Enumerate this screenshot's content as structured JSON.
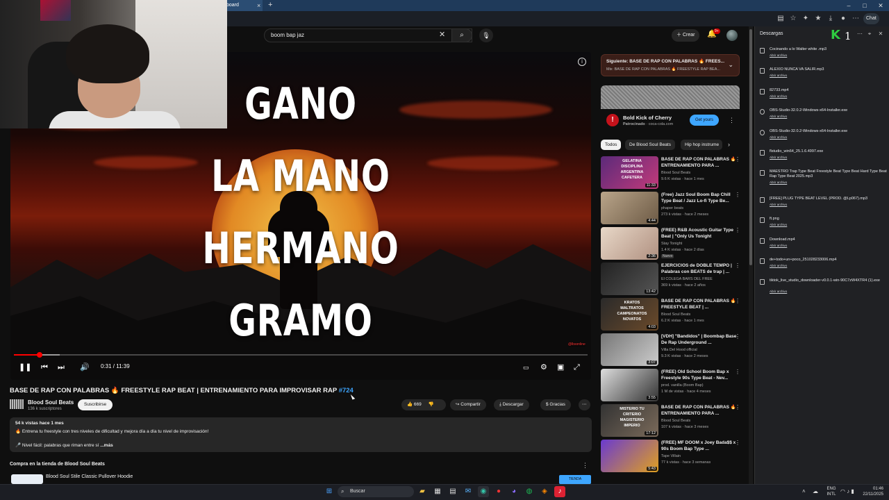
{
  "browser": {
    "tab_title": "board",
    "tab_close": "×",
    "new_tab": "+",
    "window_buttons": [
      "–",
      "□",
      "✕"
    ],
    "chat_label": "Chat"
  },
  "youtube": {
    "search": {
      "value": "boom bap jaz",
      "clear": "✕",
      "search_icon": "⌕",
      "mic_icon": "🎙"
    },
    "header": {
      "create_label": "Crear",
      "notifications_badge": "9+"
    },
    "player": {
      "overlay_lines": [
        "GANO",
        "LA MANO",
        "HERMANO",
        "GRAMO"
      ],
      "watermark": "@lbsonline",
      "time": "0:31 / 11:39",
      "progress_fraction": 0.045,
      "buffered_fraction": 0.08
    },
    "video": {
      "title": "BASE DE RAP CON PALABRAS 🔥 FREESTYLE RAP BEAT | ENTRENAMIENTO PARA IMPROVISAR RAP ",
      "hashtag": "#724",
      "channel": "Blood Soul Beats",
      "subscribers": "136 k suscriptores",
      "subscribe_label": "Suscribirse",
      "likes": "669",
      "share_label": "Compartir",
      "download_label": "Descargar",
      "thanks_label": "Gracias",
      "description": {
        "stats": "54 k vistas  hace 1 mes",
        "line1": "🔥 Entrena tu freestyle con tres niveles de dificultad y mejora día a día tu nivel de improvisación!",
        "line2": "🎤 Nivel fácil: palabras que riman entre sí",
        "more": "...más"
      },
      "shop_title": "Compra en la tienda de Blood Soul Beats",
      "shop_item": "Blood Soul Stile Classic Pullover Hoodie",
      "shop_button": "TIENDA"
    },
    "next_up": {
      "label": "Siguiente: BASE DE RAP CON PALABRAS 🔥 FREES...",
      "sub": "Mix: BASE DE RAP CON PALABRAS 🔥 FREESTYLE RAP BEA..."
    },
    "ad": {
      "title": "Bold Kick of Cherry",
      "sponsor": "Patrocinado",
      "domain": "coca-cola.com",
      "button": "Get yours"
    },
    "chips": [
      "Todos",
      "De Blood Soul Beats",
      "Hip hop instrume"
    ],
    "recommendations": [
      {
        "title": "BASE DE RAP CON PALABRAS 🔥 ENTRENAMIENTO PARA ...",
        "channel": "Blood Soul Beats",
        "meta": "9.6 K vistas · hace 1 mes",
        "duration": "11:33",
        "thumb_text": "GELATINA DISCIPLINA ARGENTINA CAFETERA",
        "badge": ""
      },
      {
        "title": "(Free) Jazz Soul Boom Bap Chill Type Beat / Jazz Lo-fi Type Be...",
        "channel": "phaper beats",
        "meta": "273 k vistas · hace 2 meses",
        "duration": "4:44",
        "thumb_text": "",
        "badge": ""
      },
      {
        "title": "(FREE) R&B Acoustic Guitar Type Beat | \"Only Us Tonight",
        "channel": "Stay Tonight",
        "meta": "1.4 K vistas · hace 2 días",
        "duration": "2:36",
        "thumb_text": "",
        "badge": "Nuevo"
      },
      {
        "title": "EJERCICIOS de DOBLE TEMPO | Palabras con BEATS de trap | ...",
        "channel": "El COLEGA BARS DEL FREE",
        "meta": "369 k vistas · hace 2 años",
        "duration": "13:42",
        "thumb_text": "",
        "badge": ""
      },
      {
        "title": "BASE DE RAP CON PALABRAS 🔥 FREESTYLE BEAT | ...",
        "channel": "Blood Soul Beats",
        "meta": "6.2 K vistas · hace 1 mes",
        "duration": "4:03",
        "thumb_text": "KRATOS MALTRATOS CAMPEONATOS NOVATOS",
        "badge": ""
      },
      {
        "title": "[VDH] \"Bandidos\" | Boombap Base De Rap Underground ...",
        "channel": "Villa Del Hood official",
        "meta": "9.3 K vistas · hace 2 meses",
        "duration": "3:07",
        "thumb_text": "",
        "badge": ""
      },
      {
        "title": "(FREE) Old School Boom Bap x Freestyle 90s Type Beat - Nev...",
        "channel": "prod. vanilla (Boom Bap)",
        "meta": "1 M de vistas · hace 4 meses",
        "duration": "3:55",
        "thumb_text": "",
        "badge": ""
      },
      {
        "title": "BASE DE RAP CON PALABRAS 🔥 ENTRENAMIENTO PARA ...",
        "channel": "Blood Soul Beats",
        "meta": "107 k vistas · hace 3 meses",
        "duration": "17:12",
        "thumb_text": "MISTERIO TU CRITERIO MAGISTERIO IMPERIO",
        "badge": ""
      },
      {
        "title": "(FREE) MF DOOM x Joey Bada$$ x 90s Boom Bap Type ...",
        "channel": "Tape Villain",
        "meta": "77 k vistas · hace 3 semanas",
        "duration": "5:43",
        "thumb_text": "",
        "badge": ""
      }
    ]
  },
  "downloads": {
    "title": "Descargas",
    "open_label": "Abrir archivo",
    "items": [
      {
        "name": "Cocinando a lo Walter white .mp3",
        "link": "Abrir archivo",
        "icon": "file"
      },
      {
        "name": "ALEXIO NUNCA VA SALIR.mp3",
        "link": "Abrir archivo",
        "icon": "file"
      },
      {
        "name": "82733.mp4",
        "link": "Abrir archivo",
        "icon": "file"
      },
      {
        "name": "OBS-Studio-32.0.2-Windows-x64-Installer.exe",
        "link": "Abrir archivo",
        "icon": "round"
      },
      {
        "name": "OBS-Studio-32.0.2-Windows-x64-Installer.exe",
        "link": "Abrir archivo",
        "icon": "round"
      },
      {
        "name": "flstudio_win64_25.1.6.4997.exe",
        "link": "Abrir archivo",
        "icon": "file"
      },
      {
        "name": "MAESTRO Trap Type Beat Freestyle Beat Type Beat Hard Type Beat Rap Type Beat 2025.mp3",
        "link": "Abrir archivo",
        "icon": "file"
      },
      {
        "name": "[FREE] PLUG TYPE BEAT LEVEL (PROD. @Lp067).mp3",
        "link": "Abrir archivo",
        "icon": "file"
      },
      {
        "name": "ft.png",
        "link": "Abrir archivo",
        "icon": "file"
      },
      {
        "name": "Download.mp4",
        "link": "Abrir archivo",
        "icon": "file"
      },
      {
        "name": "de+todo+un+poco_251028233006.mp4",
        "link": "Abrir archivo",
        "icon": "file"
      },
      {
        "name": "tiktok_live_studio_downloader-v0.0.1-win-90C7zW4XTR4 (1).exe",
        "link": "Abrir archivo",
        "icon": "file"
      }
    ]
  },
  "overlay": {
    "kick_logo": "K",
    "number": "1"
  },
  "taskbar": {
    "search_label": "Buscar",
    "lang": "ENG",
    "lang_sub": "INTL",
    "time": "01:46",
    "date": "22/11/2025"
  },
  "colors": {
    "accent": "#3ea6ff",
    "red": "#ff0000",
    "kick": "#2ecc40"
  }
}
